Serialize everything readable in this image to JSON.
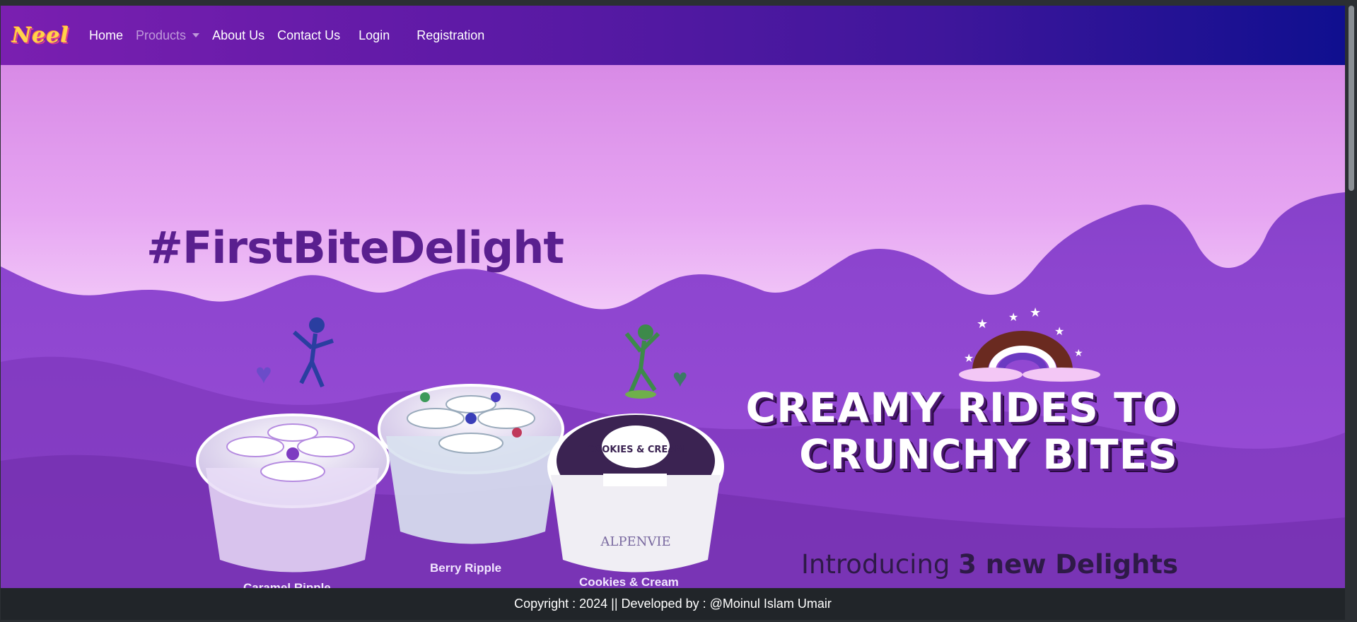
{
  "nav": {
    "brand": "Neel",
    "items": [
      {
        "label": "Home"
      },
      {
        "label": "Products"
      },
      {
        "label": "About Us"
      },
      {
        "label": "Contact Us"
      },
      {
        "label": "Login"
      },
      {
        "label": "Registration"
      }
    ]
  },
  "hero": {
    "hashtag": "#FirstBiteDelight",
    "headline_line1": "CREAMY RIDES TO",
    "headline_line2": "CRUNCHY BITES",
    "subline_prefix": "Introducing ",
    "subline_bold": "3 new Delights",
    "products": [
      {
        "name": "Caramel Ripple"
      },
      {
        "name": "Berry Ripple"
      },
      {
        "name": "Cookies & Cream"
      }
    ],
    "cup_lid_text": "COOKIES & CREAM",
    "cup_brand_2": "ALPENVIE"
  },
  "footer": {
    "text": "Copyright : 2024 || Developed by : @Moinul Islam Umair"
  },
  "colors": {
    "nav_start": "#7a1fb0",
    "nav_end": "#0f0f8f",
    "footer_bg": "#212529",
    "hero_purple": "#8d45cf",
    "cream": "#e6a5f2"
  }
}
